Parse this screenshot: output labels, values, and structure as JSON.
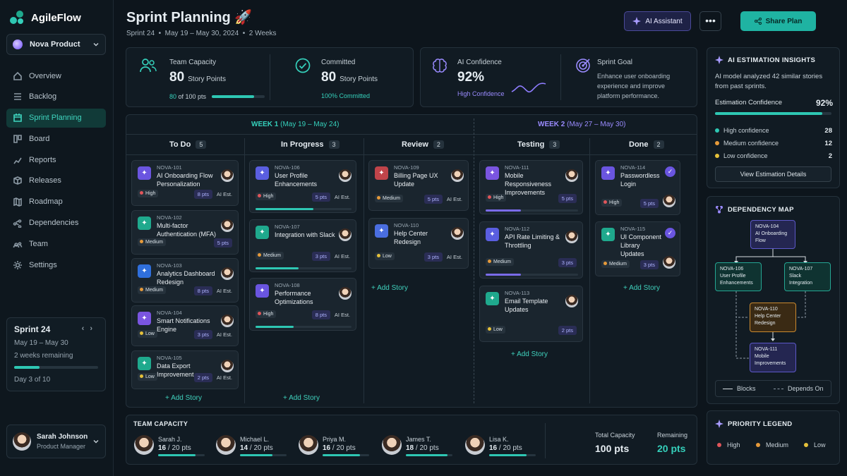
{
  "app": {
    "name": "AgileFlow",
    "product": "Nova Product"
  },
  "nav": [
    {
      "label": "Overview",
      "icon": "home-icon"
    },
    {
      "label": "Backlog",
      "icon": "list-icon"
    },
    {
      "label": "Sprint Planning",
      "icon": "calendar-icon",
      "active": true
    },
    {
      "label": "Board",
      "icon": "board-icon"
    },
    {
      "label": "Reports",
      "icon": "chart-icon"
    },
    {
      "label": "Releases",
      "icon": "box-icon"
    },
    {
      "label": "Roadmap",
      "icon": "map-icon"
    },
    {
      "label": "Dependencies",
      "icon": "share-icon"
    },
    {
      "label": "Team",
      "icon": "team-icon"
    },
    {
      "label": "Settings",
      "icon": "gear-icon"
    }
  ],
  "sprint": {
    "name": "Sprint 24",
    "dates": "May 19 – May 30",
    "remaining": "2 weeks remaining",
    "day": "Day 3 of 10",
    "progress": 0.3
  },
  "user": {
    "name": "Sarah Johnson",
    "role": "Product Manager"
  },
  "header": {
    "title": "Sprint Planning",
    "emoji": "🚀",
    "sprint": "Sprint 24",
    "dates": "May 19 – May 30, 2024",
    "duration": "2 Weeks",
    "ai_button": "AI Assistant",
    "more": "•••",
    "share_button": "Share Plan"
  },
  "stats": {
    "capacity": {
      "label": "Team Capacity",
      "value": "80",
      "unit": "Story Points",
      "used": "80",
      "total": "of 100 pts",
      "fraction": 0.8
    },
    "committed": {
      "label": "Committed",
      "value": "80",
      "unit": "Story Points",
      "note": "100% Committed"
    },
    "ai_confidence": {
      "label": "AI Confidence",
      "value": "92%",
      "note": "High Confidence"
    },
    "goal": {
      "label": "Sprint Goal",
      "text": "Enhance user onboarding experience and improve platform performance."
    }
  },
  "weeks": [
    {
      "label": "WEEK 1",
      "range": "(May 19 – May 24)",
      "color": "#35d0bb"
    },
    {
      "label": "WEEK 2",
      "range": "(May 27 – May 30)",
      "color": "#9a8bff"
    }
  ],
  "columns": [
    {
      "name": "To Do",
      "count": "5",
      "cards": [
        {
          "id": "NOVA-101",
          "title": "AI Onboarding Flow Personalization",
          "priority": "High",
          "points": "8 pts",
          "ai": "AI Est.",
          "icon_color": "#6a55e0"
        },
        {
          "id": "NOVA-102",
          "title": "Multi-factor Authentication (MFA)",
          "priority": "Medium",
          "points": "5 pts",
          "ai": "",
          "icon_color": "#1fa98d"
        },
        {
          "id": "NOVA-103",
          "title": "Analytics Dashboard Redesign",
          "priority": "Medium",
          "points": "8 pts",
          "ai": "AI Est.",
          "icon_color": "#2f6fdc"
        },
        {
          "id": "NOVA-104",
          "title": "Smart Notifications Engine",
          "priority": "Low",
          "points": "3 pts",
          "ai": "AI Est.",
          "icon_color": "#7a55e0"
        },
        {
          "id": "NOVA-105",
          "title": "Data Export Improvement",
          "priority": "Low",
          "points": "2 pts",
          "ai": "AI Est.",
          "icon_color": "#1fa98d"
        }
      ],
      "add": "+ Add Story"
    },
    {
      "name": "In Progress",
      "count": "3",
      "cards": [
        {
          "id": "NOVA-106",
          "title": "User Profile Enhancements",
          "priority": "High",
          "points": "5 pts",
          "ai": "AI Est.",
          "icon_color": "#5a5ee0",
          "progress": 0.6
        },
        {
          "id": "NOVA-107",
          "title": "Integration with Slack",
          "priority": "Medium",
          "points": "3 pts",
          "ai": "AI Est.",
          "icon_color": "#1fa98d",
          "progress": 0.45
        },
        {
          "id": "NOVA-108",
          "title": "Performance Optimizations",
          "priority": "High",
          "points": "8 pts",
          "ai": "AI Est.",
          "icon_color": "#6a55e0",
          "progress": 0.4
        }
      ],
      "add": "+ Add Story"
    },
    {
      "name": "Review",
      "count": "2",
      "cards": [
        {
          "id": "NOVA-109",
          "title": "Billing Page UX Update",
          "priority": "Medium",
          "points": "5 pts",
          "ai": "AI Est.",
          "icon_color": "#c0444a"
        },
        {
          "id": "NOVA-110",
          "title": "Help Center Redesign",
          "priority": "Low",
          "points": "3 pts",
          "ai": "AI Est.",
          "icon_color": "#4a6ee0"
        }
      ],
      "add": "+ Add Story"
    },
    {
      "name": "Testing",
      "count": "3",
      "cards": [
        {
          "id": "NOVA-111",
          "title": "Mobile Responsiveness Improvements",
          "priority": "High",
          "points": "5 pts",
          "icon_color": "#7a55e0",
          "progress": 0.38
        },
        {
          "id": "NOVA-112",
          "title": "API Rate Limiting & Throttling",
          "priority": "Medium",
          "points": "3 pts",
          "icon_color": "#5a5ee0",
          "progress": 0.38
        },
        {
          "id": "NOVA-113",
          "title": "Email Template Updates",
          "priority": "Low",
          "points": "2 pts",
          "icon_color": "#1fa98d"
        }
      ],
      "add": "+ Add Story"
    },
    {
      "name": "Done",
      "count": "2",
      "cards": [
        {
          "id": "NOVA-114",
          "title": "Passwordless Login",
          "priority": "High",
          "points": "5 pts",
          "icon_color": "#6a55e0"
        },
        {
          "id": "NOVA-115",
          "title": "UI Component Library Updates",
          "priority": "Medium",
          "points": "3 pts",
          "icon_color": "#1fa98d"
        }
      ],
      "add": "+ Add Story"
    }
  ],
  "team": {
    "title": "TEAM CAPACITY",
    "members": [
      {
        "name": "Sarah J.",
        "used": "16",
        "total": "/ 20 pts",
        "fraction": 0.8
      },
      {
        "name": "Michael L.",
        "used": "14",
        "total": "/ 20 pts",
        "fraction": 0.7
      },
      {
        "name": "Priya M.",
        "used": "16",
        "total": "/ 20 pts",
        "fraction": 0.8
      },
      {
        "name": "James T.",
        "used": "18",
        "total": "/ 20 pts",
        "fraction": 0.9
      },
      {
        "name": "Lisa K.",
        "used": "16",
        "total": "/ 20 pts",
        "fraction": 0.8
      }
    ],
    "total_label": "Total Capacity",
    "total_value": "100 pts",
    "remaining_label": "Remaining",
    "remaining_value": "20 pts"
  },
  "insights": {
    "title": "AI ESTIMATION INSIGHTS",
    "text": "AI model analyzed 42 similar stories from past sprints.",
    "conf_label": "Estimation Confidence",
    "conf_value": "92%",
    "conf_fraction": 0.92,
    "rows": [
      {
        "label": "High confidence",
        "value": "28",
        "color": "#2ec7b3"
      },
      {
        "label": "Medium confidence",
        "value": "12",
        "color": "#e69a3a"
      },
      {
        "label": "Low confidence",
        "value": "2",
        "color": "#e5c13a"
      }
    ],
    "button": "View Estimation Details"
  },
  "dependency": {
    "title": "DEPENDENCY MAP",
    "nodes": [
      {
        "id": "NOVA-104",
        "title": "AI Onboarding Flow"
      },
      {
        "id": "NOVA-106",
        "title": "User Profile Enhancements"
      },
      {
        "id": "NOVA-107",
        "title": "Slack Integration"
      },
      {
        "id": "NOVA-110",
        "title": "Help Center Redesign"
      },
      {
        "id": "NOVA-111",
        "title": "Mobile Improvements"
      }
    ],
    "legend_blocks": "Blocks",
    "legend_depends": "Depends On"
  },
  "priority_legend": {
    "title": "PRIORITY LEGEND",
    "items": [
      {
        "label": "High",
        "color": "#e0555a"
      },
      {
        "label": "Medium",
        "color": "#e69a3a"
      },
      {
        "label": "Low",
        "color": "#e5c13a"
      }
    ]
  },
  "colors": {
    "accent": "#2ec7b3",
    "purple": "#9a8bff",
    "high": "#e0555a",
    "medium": "#e69a3a",
    "low": "#e5c13a"
  }
}
